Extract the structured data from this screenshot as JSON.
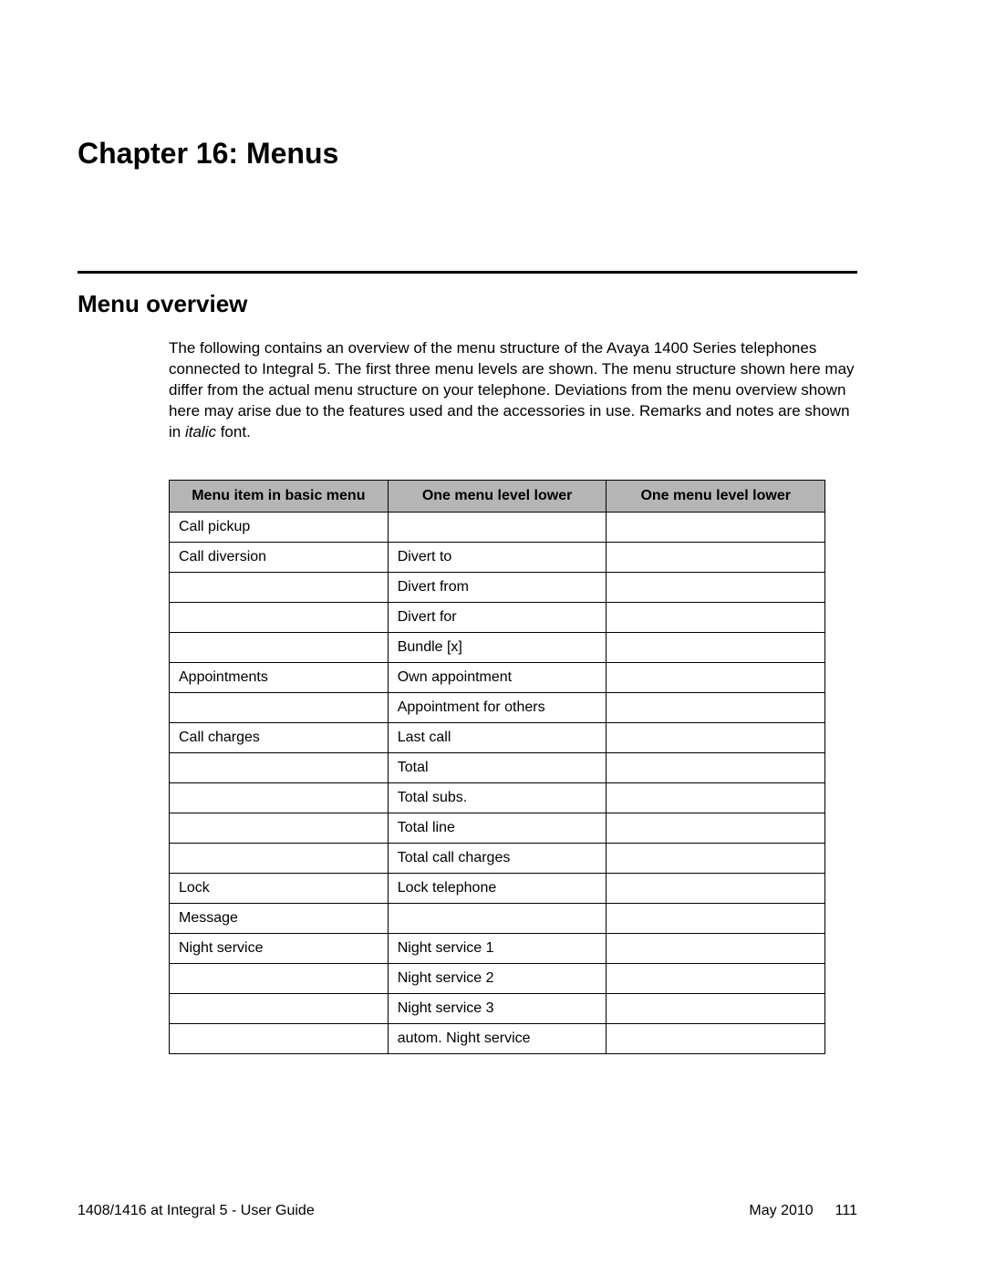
{
  "chapter": {
    "title": "Chapter 16: Menus"
  },
  "section": {
    "title": "Menu overview",
    "paragraph_pre": "The following contains an overview of the menu structure of the Avaya 1400 Series telephones connected to Integral 5. The first three menu levels are shown. The menu structure shown here may differ from the actual menu structure on your telephone. Deviations from the menu overview shown here may arise due to the features used and the accessories in use. Remarks and notes are shown in ",
    "paragraph_italic": "italic",
    "paragraph_post": " font."
  },
  "table": {
    "headers": [
      "Menu item in basic menu",
      "One menu level lower",
      "One menu level lower"
    ],
    "rows": [
      [
        "Call pickup",
        "",
        ""
      ],
      [
        "Call diversion",
        "Divert to",
        ""
      ],
      [
        "",
        "Divert from",
        ""
      ],
      [
        "",
        "Divert for",
        ""
      ],
      [
        "",
        "Bundle [x]",
        ""
      ],
      [
        "Appointments",
        "Own appointment",
        ""
      ],
      [
        "",
        "Appointment for others",
        ""
      ],
      [
        "Call charges",
        "Last call",
        ""
      ],
      [
        "",
        "Total",
        ""
      ],
      [
        "",
        "Total subs.",
        ""
      ],
      [
        "",
        "Total line",
        ""
      ],
      [
        "",
        "Total call charges",
        ""
      ],
      [
        "Lock",
        "Lock telephone",
        ""
      ],
      [
        "Message",
        "",
        ""
      ],
      [
        "Night service",
        "Night service 1",
        ""
      ],
      [
        "",
        "Night service 2",
        ""
      ],
      [
        "",
        "Night service 3",
        ""
      ],
      [
        "",
        "autom. Night service",
        ""
      ]
    ]
  },
  "footer": {
    "left": "1408/1416 at Integral 5 - User Guide",
    "date": "May 2010",
    "page": "111"
  }
}
